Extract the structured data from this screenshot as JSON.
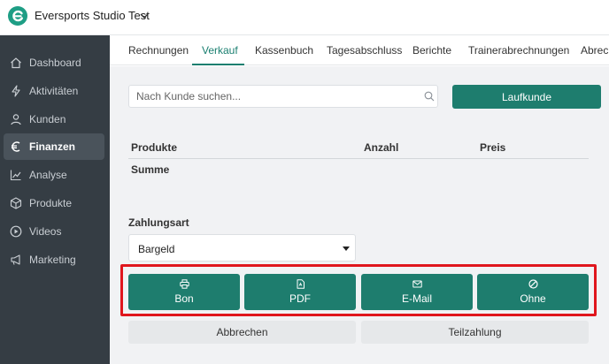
{
  "header": {
    "studio_name": "Eversports Studio Test"
  },
  "sidebar": {
    "items": [
      {
        "label": "Dashboard",
        "icon": "home-icon",
        "active": false
      },
      {
        "label": "Aktivitäten",
        "icon": "bolt-icon",
        "active": false
      },
      {
        "label": "Kunden",
        "icon": "user-icon",
        "active": false
      },
      {
        "label": "Finanzen",
        "icon": "euro-icon",
        "active": true
      },
      {
        "label": "Analyse",
        "icon": "chart-line-icon",
        "active": false
      },
      {
        "label": "Produkte",
        "icon": "box-icon",
        "active": false
      },
      {
        "label": "Videos",
        "icon": "play-circle-icon",
        "active": false
      },
      {
        "label": "Marketing",
        "icon": "megaphone-icon",
        "active": false
      }
    ]
  },
  "tabs": [
    {
      "label": "Rechnungen",
      "active": false
    },
    {
      "label": "Verkauf",
      "active": true
    },
    {
      "label": "Kassenbuch",
      "active": false
    },
    {
      "label": "Tagesabschluss",
      "active": false
    },
    {
      "label": "Berichte",
      "active": false
    },
    {
      "label": "Trainerabrechnungen",
      "active": false
    },
    {
      "label": "Abrechnungen",
      "active": false
    }
  ],
  "search": {
    "placeholder": "Nach Kunde suchen...",
    "value": ""
  },
  "laufkunde_label": "Laufkunde",
  "table": {
    "headers": [
      "Produkte",
      "Anzahl",
      "Preis"
    ],
    "sum_label": "Summe"
  },
  "payment": {
    "label": "Zahlungsart",
    "selected": "Bargeld"
  },
  "receipt_buttons": [
    {
      "label": "Bon",
      "icon": "printer-icon"
    },
    {
      "label": "PDF",
      "icon": "pdf-file-icon"
    },
    {
      "label": "E-Mail",
      "icon": "envelope-icon"
    },
    {
      "label": "Ohne",
      "icon": "ban-icon"
    }
  ],
  "footer_buttons": {
    "cancel": "Abbrechen",
    "partial": "Teilzahlung"
  },
  "colors": {
    "accent": "#1e7d6e",
    "sidebar_bg": "#353d44",
    "highlight": "#e0161d"
  }
}
